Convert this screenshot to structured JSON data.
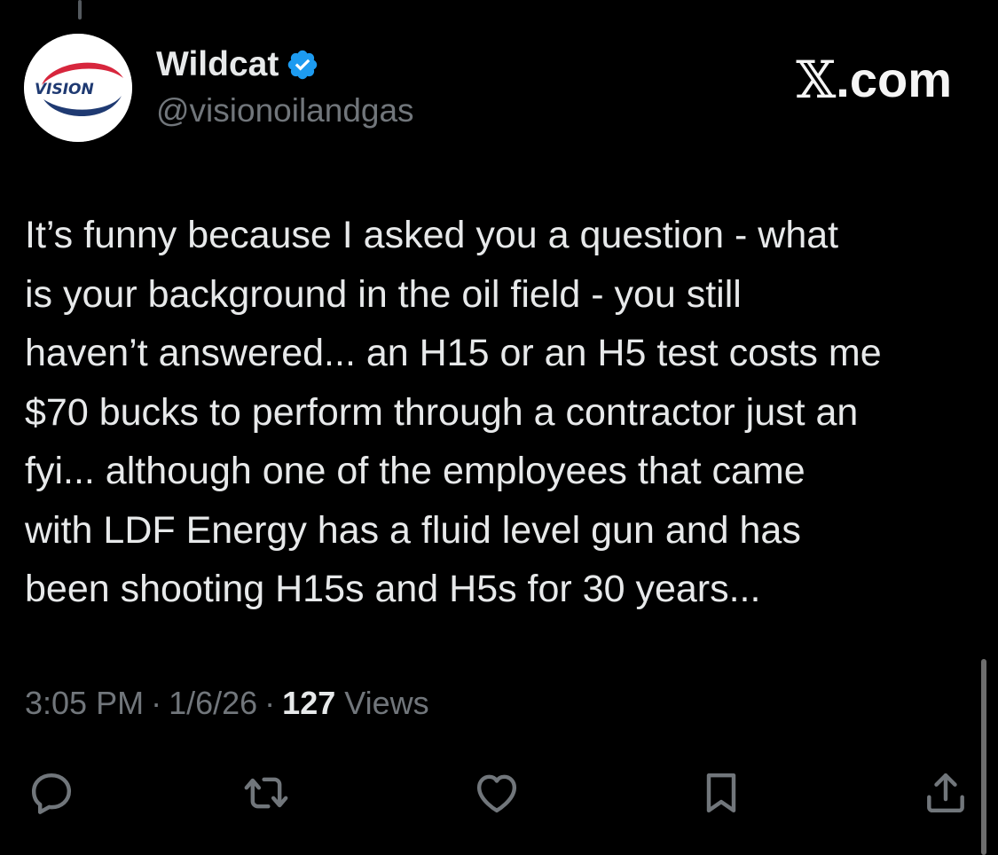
{
  "author": {
    "display_name": "Wildcat",
    "handle": "@visionoilandgas",
    "avatar_logo_text": "VISION",
    "verified_icon": "verified-badge-icon"
  },
  "brand": {
    "x_glyph": "𝕏",
    "suffix": ".com"
  },
  "tweet": {
    "text": "It’s funny because I asked you a question - what\nis your background in the oil field - you still\nhaven’t answered... an H15 or an H5 test costs me\n$70 bucks to perform through a contractor just an\nfyi... although one of the employees that came\nwith LDF Energy has a fluid level gun and has\nbeen shooting H15s and H5s for 30 years..."
  },
  "meta": {
    "time": "3:05 PM",
    "date": "1/6/26",
    "separator": "·",
    "views_count": "127",
    "views_label": "Views"
  },
  "actions": [
    {
      "icon": "reply-icon"
    },
    {
      "icon": "retweet-icon"
    },
    {
      "icon": "like-icon"
    },
    {
      "icon": "bookmark-icon"
    },
    {
      "icon": "share-icon"
    }
  ],
  "colors": {
    "background": "#000000",
    "text": "#e7e9ea",
    "secondary": "#71767b",
    "verified": "#1d9bf0",
    "logo_red": "#d7263d",
    "logo_navy": "#1f3a72"
  }
}
